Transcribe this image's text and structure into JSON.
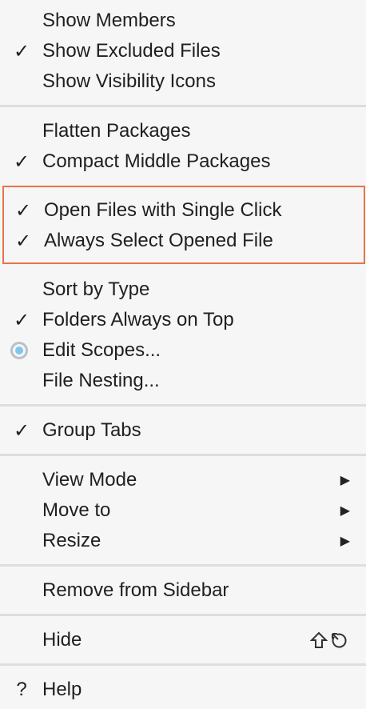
{
  "sections": [
    [
      {
        "label": "Show Members",
        "checked": false
      },
      {
        "label": "Show Excluded Files",
        "checked": true
      },
      {
        "label": "Show Visibility Icons",
        "checked": false
      }
    ],
    [
      {
        "label": "Flatten Packages",
        "checked": false
      },
      {
        "label": "Compact Middle Packages",
        "checked": true
      }
    ],
    [
      {
        "label": "Open Files with Single Click",
        "checked": true
      },
      {
        "label": "Always Select Opened File",
        "checked": true
      }
    ],
    [
      {
        "label": "Sort by Type",
        "checked": false
      },
      {
        "label": "Folders Always on Top",
        "checked": true
      },
      {
        "label": "Edit Scopes...",
        "radio": true
      },
      {
        "label": "File Nesting...",
        "checked": false
      }
    ],
    [
      {
        "label": "Group Tabs",
        "checked": true
      }
    ],
    [
      {
        "label": "View Mode",
        "submenu": true
      },
      {
        "label": "Move to",
        "submenu": true
      },
      {
        "label": "Resize",
        "submenu": true
      }
    ],
    [
      {
        "label": "Remove from Sidebar"
      }
    ],
    [
      {
        "label": "Hide",
        "shortcut": "⇧↺"
      }
    ],
    [
      {
        "label": "Help",
        "icon": "?"
      }
    ]
  ],
  "glyphs": {
    "check": "✓",
    "submenu": "▶"
  },
  "highlight_color": "#e8744a"
}
